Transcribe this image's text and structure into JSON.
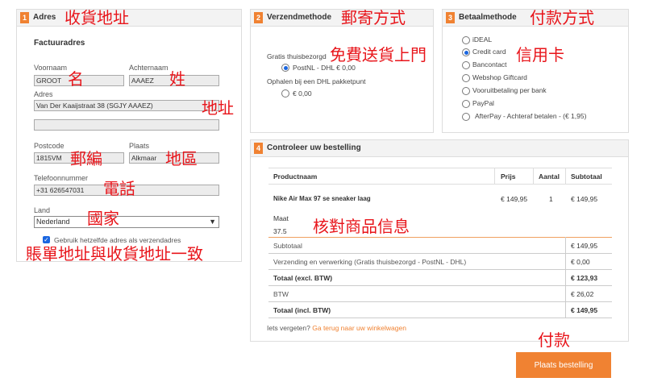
{
  "address": {
    "step": "1",
    "title": "Adres",
    "annotation": "收貨地址",
    "subtitle": "Factuuradres",
    "first_name_label": "Voornaam",
    "first_name_value": "GROOT",
    "first_name_annotation": "名",
    "last_name_label": "Achternaam",
    "last_name_value": "AAAEZ",
    "last_name_annotation": "姓",
    "address_label": "Adres",
    "address_value": "Van Der Kaaijstraat 38  (SGJY AAAEZ)",
    "address2_value": "",
    "address_annotation": "地址",
    "postcode_label": "Postcode",
    "postcode_value": "1815VM",
    "postcode_annotation": "郵編",
    "city_label": "Plaats",
    "city_value": "Alkmaar",
    "city_annotation": "地區",
    "phone_label": "Telefoonnummer",
    "phone_value": "+31 626547031",
    "phone_annotation": "電話",
    "country_label": "Land",
    "country_value": "Nederland",
    "country_annotation": "國家",
    "same_address_label": "Gebruik hetzelfde adres als verzendadres",
    "same_address_checked": true,
    "same_address_annotation": "賬單地址與收貨地址一致"
  },
  "shipping": {
    "step": "2",
    "title": "Verzendmethode",
    "annotation": "郵寄方式",
    "group1_label": "Gratis thuisbezorgd",
    "option1": "PostNL - DHL € 0,00",
    "group2_label": "Ophalen bij een DHL pakketpunt",
    "option2": "€ 0,00",
    "free_annotation": "免費送貨上門"
  },
  "payment": {
    "step": "3",
    "title": "Betaalmethode",
    "annotation": "付款方式",
    "options": [
      "iDEAL",
      "Credit card",
      "Bancontact",
      "Webshop Giftcard",
      "Vooruitbetaling per bank",
      "PayPal",
      "AfterPay - Achteraf betalen - (€ 1,95)"
    ],
    "selected_index": 1,
    "card_annotation": "信用卡"
  },
  "review": {
    "step": "4",
    "title": "Controleer uw bestelling",
    "annotation": "核對商品信息",
    "headers": {
      "product": "Productnaam",
      "price": "Prijs",
      "qty": "Aantal",
      "subtotal": "Subtotaal"
    },
    "item": {
      "name": "Nike Air Max 97 se sneaker laag",
      "price": "€ 149,95",
      "qty": "1",
      "subtotal": "€ 149,95",
      "size_label": "Maat",
      "size_value": "37.5"
    },
    "totals": [
      {
        "label": "Subtotaal",
        "value": "€ 149,95",
        "bold": false
      },
      {
        "label": "Verzending en verwerking (Gratis thuisbezorgd - PostNL - DHL)",
        "value": "€ 0,00",
        "bold": false
      },
      {
        "label": "Totaal (excl. BTW)",
        "value": "€ 123,93",
        "bold": true
      },
      {
        "label": "BTW",
        "value": "€ 26,02",
        "bold": false
      },
      {
        "label": "Totaal (incl. BTW)",
        "value": "€ 149,95",
        "bold": true
      }
    ],
    "forgot_text": "Iets vergeten?",
    "back_link": "Ga terug naar uw winkelwagen"
  },
  "checkout": {
    "button_label": "Plaats bestelling",
    "annotation": "付款"
  },
  "colors": {
    "accent": "#f08232",
    "annotation": "#e8151b",
    "radio": "#1a66e0"
  }
}
